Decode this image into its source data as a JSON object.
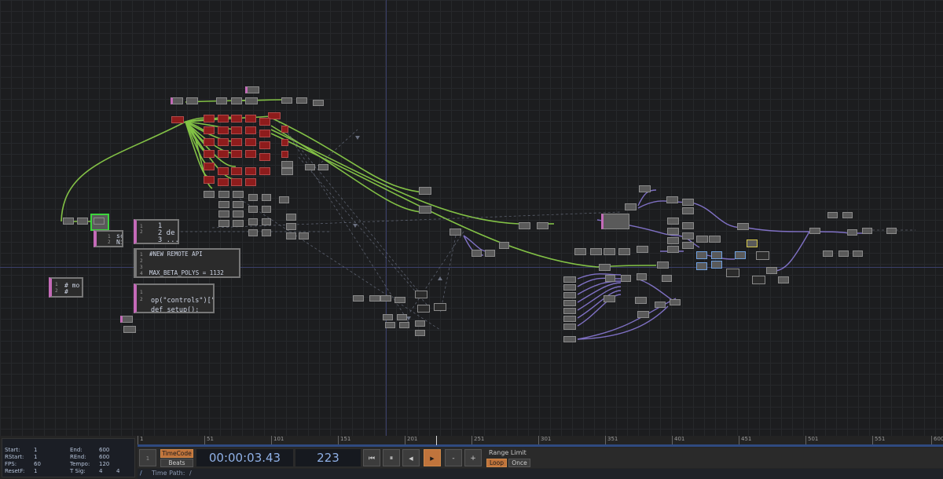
{
  "network": {
    "text_dats": {
      "dat_a": {
        "lines": [
          "1",
          "2"
        ],
        "text": "  1\n  2 de\n  3 ..."
      },
      "dat_b": {
        "lines": [
          "1",
          "2",
          "3",
          "4"
        ],
        "text": "#NEW REMOTE API\n\n\nMAX_BETA_POLYS = 1132"
      },
      "dat_c": {
        "lines": [
          "1",
          "2"
        ],
        "text": "op(\"controls\")[\"\ndef setup():"
      },
      "dat_d": {
        "lines": [
          "1",
          "2"
        ],
        "text": "# mo\n#"
      },
      "dat_e": {
        "lines": [
          "1",
          "2"
        ],
        "text": "sc\nNi"
      }
    }
  },
  "stats": {
    "start_label": "Start:",
    "start_value": "1",
    "rstart_label": "RStart:",
    "rstart_value": "1",
    "fps_label": "FPS:",
    "fps_value": "60",
    "resetf_label": "ResetF:",
    "resetf_value": "1",
    "end_label": "End:",
    "end_value": "600",
    "rend_label": "REnd:",
    "rend_value": "600",
    "tempo_label": "Tempo:",
    "tempo_value": "120",
    "tsig_label": "T Sig:",
    "tsig_num": "4",
    "tsig_den": "4"
  },
  "timeline": {
    "ruler_ticks": [
      "1",
      "51",
      "101",
      "151",
      "201",
      "251",
      "301",
      "351",
      "401",
      "451",
      "501",
      "551",
      "600"
    ],
    "current_frame_marker": "1",
    "timecode_label": "TimeCode",
    "beats_label": "Beats",
    "timecode": "00:00:03.43",
    "frame": "223",
    "range_limit_label": "Range Limit",
    "loop_label": "Loop",
    "once_label": "Once",
    "time_path_label": "Time Path:",
    "time_path_value": "/",
    "path_slash": "/"
  },
  "colors": {
    "accent_orange": "#c0743c",
    "wire_green": "#8ed34a",
    "wire_purple": "#8a7ad6",
    "node_red": "#8e1c1c",
    "timecode_blue": "#8fb0e6"
  }
}
